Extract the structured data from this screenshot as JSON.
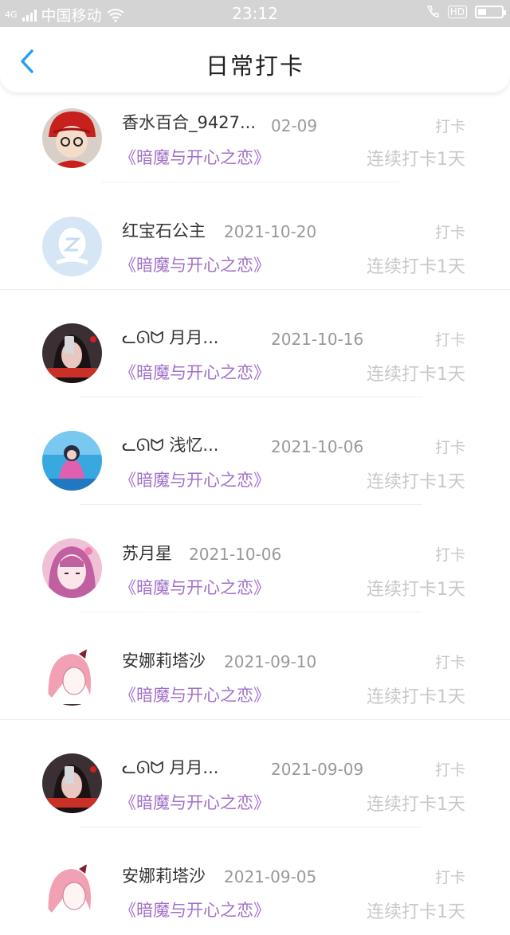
{
  "status_bar": {
    "carrier": "中国移动",
    "network": "4G",
    "time": "23:12",
    "hd": "HD",
    "battery_level": 0.35
  },
  "nav": {
    "title": "日常打卡",
    "back_icon": "chevron-left-icon"
  },
  "colors": {
    "accent_blue": "#2a9ef2",
    "book_purple": "#a070c8",
    "muted_gray": "#c8c8c8"
  },
  "entries": [
    {
      "name": "香水百合_9427...",
      "date": "02-09",
      "action": "打卡",
      "book": "《暗魔与开心之恋》",
      "streak": "连续打卡1天",
      "avatar": "avatar-red-hat-icon"
    },
    {
      "name": "红宝石公主",
      "date": "2021-10-20",
      "action": "打卡",
      "book": "《暗魔与开心之恋》",
      "streak": "连续打卡1天",
      "avatar": "avatar-default-icon"
    },
    {
      "name": "月月...",
      "date": "2021-10-16",
      "action": "打卡",
      "book": "《暗魔与开心之恋》",
      "streak": "连续打卡1天",
      "avatar": "avatar-girl-photo-icon"
    },
    {
      "name": "浅忆...",
      "date": "2021-10-06",
      "action": "打卡",
      "book": "《暗魔与开心之恋》",
      "streak": "连续打卡1天",
      "avatar": "avatar-blue-girl-icon"
    },
    {
      "name": "苏月星",
      "date": "2021-10-06",
      "action": "打卡",
      "book": "《暗魔与开心之恋》",
      "streak": "连续打卡1天",
      "avatar": "avatar-pink-anime-icon"
    },
    {
      "name": "安娜莉塔沙",
      "date": "2021-09-10",
      "action": "打卡",
      "book": "《暗魔与开心之恋》",
      "streak": "连续打卡1天",
      "avatar": "avatar-pink-hair-icon"
    },
    {
      "name": "月月...",
      "date": "2021-09-09",
      "action": "打卡",
      "book": "《暗魔与开心之恋》",
      "streak": "连续打卡1天",
      "avatar": "avatar-girl-photo-icon"
    },
    {
      "name": "安娜莉塔沙",
      "date": "2021-09-05",
      "action": "打卡",
      "book": "《暗魔与开心之恋》",
      "streak": "连续打卡1天",
      "avatar": "avatar-pink-hair-icon"
    }
  ]
}
